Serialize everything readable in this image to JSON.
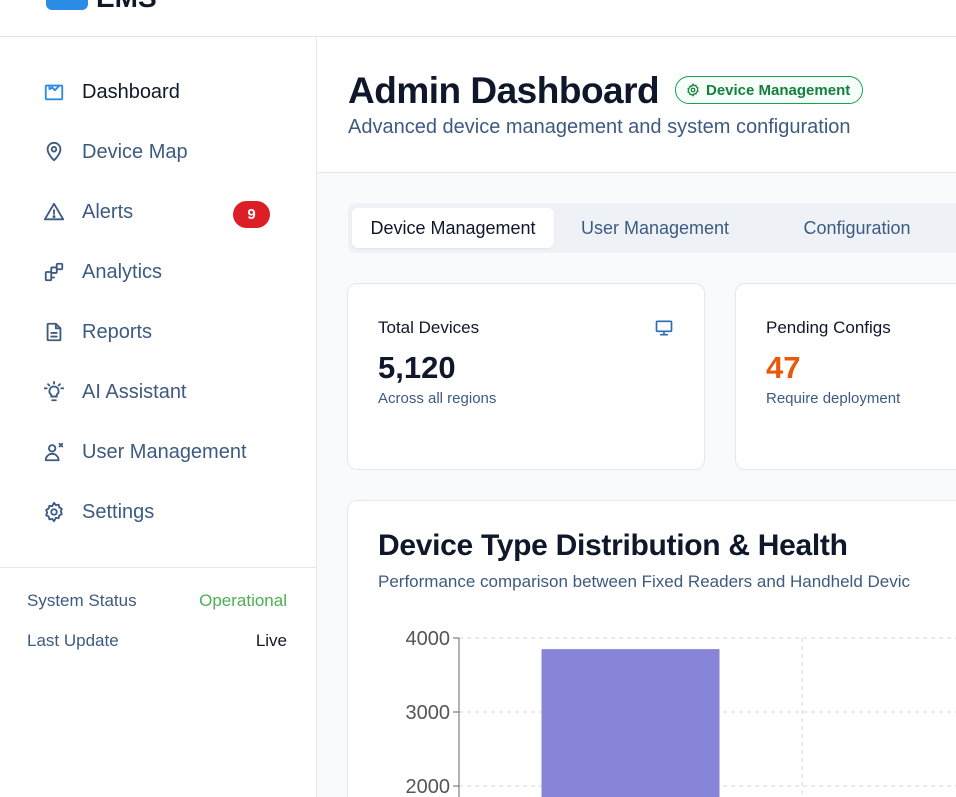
{
  "app": {
    "logo_text": "EMS"
  },
  "sidebar": {
    "items": [
      {
        "label": "Dashboard",
        "icon": "dashboard-icon",
        "active": true
      },
      {
        "label": "Device Map",
        "icon": "map-pin-icon"
      },
      {
        "label": "Alerts",
        "icon": "alert-triangle-icon",
        "badge": "9"
      },
      {
        "label": "Analytics",
        "icon": "analytics-icon"
      },
      {
        "label": "Reports",
        "icon": "file-text-icon"
      },
      {
        "label": "AI Assistant",
        "icon": "lightbulb-icon"
      },
      {
        "label": "User Management",
        "icon": "user-cog-icon"
      },
      {
        "label": "Settings",
        "icon": "gear-icon"
      }
    ],
    "status": [
      {
        "key": "System Status",
        "value": "Operational"
      },
      {
        "key": "Last Update",
        "value": "Live"
      }
    ]
  },
  "header": {
    "title": "Admin Dashboard",
    "badge": "Device Management",
    "subtitle": "Advanced device management and system configuration"
  },
  "tabs": [
    "Device Management",
    "User Management",
    "Configuration"
  ],
  "stats": [
    {
      "title": "Total Devices",
      "value": "5,120",
      "note": "Across all regions",
      "icon": "monitor-icon"
    },
    {
      "title": "Pending Configs",
      "value": "47",
      "note": "Require deployment"
    }
  ],
  "chart_card": {
    "title": "Device Type Distribution & Health",
    "subtitle": "Performance comparison between Fixed Readers and Handheld Devic"
  },
  "chart_data": {
    "type": "bar",
    "categories": [
      "",
      ""
    ],
    "values": [
      3850,
      null
    ],
    "ylim": [
      2000,
      4000
    ],
    "yticks": [
      "4000",
      "3000",
      "2000"
    ],
    "grid": true,
    "colors": {
      "bar": "#8884d8"
    }
  },
  "colors": {
    "alert_badge": "#dc1f26",
    "operational": "#4caf50",
    "pending_value": "#ea580c",
    "pill_green": "#15803d"
  }
}
